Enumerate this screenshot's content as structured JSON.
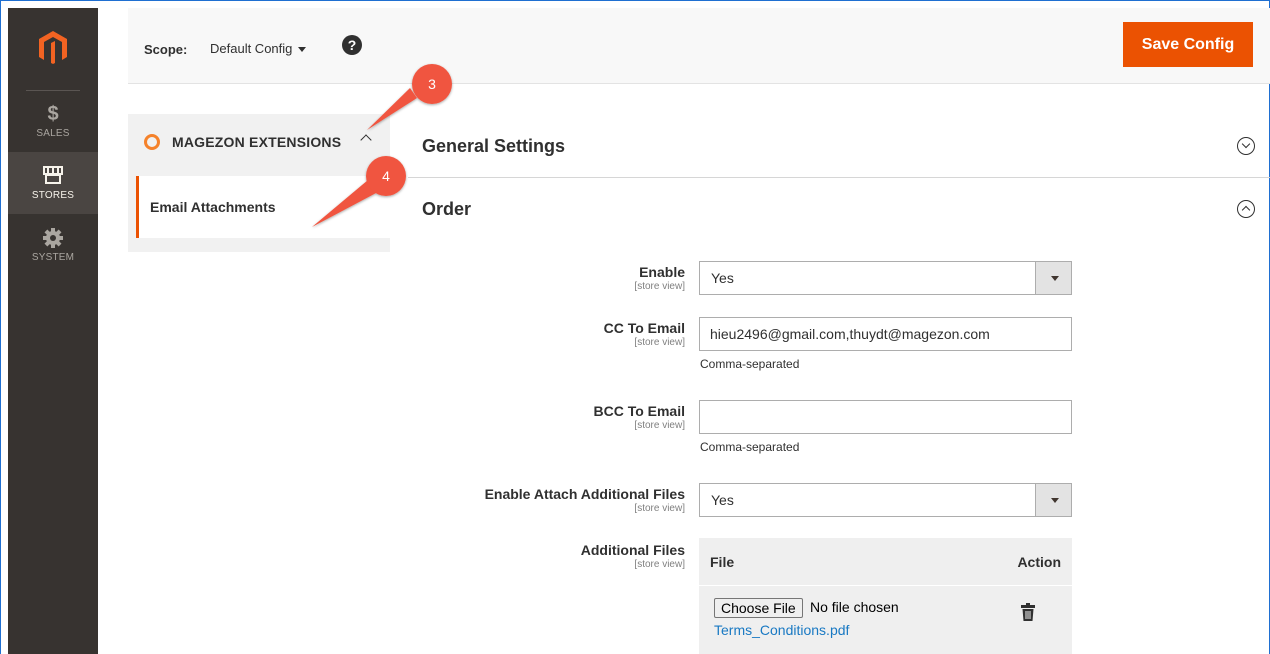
{
  "sidebar": {
    "items": [
      {
        "label": "SALES",
        "icon": "dollar-icon",
        "glyph": "$"
      },
      {
        "label": "STORES",
        "icon": "store-icon",
        "glyph": ""
      },
      {
        "label": "SYSTEM",
        "icon": "gear-icon",
        "glyph": ""
      }
    ],
    "active": "STORES"
  },
  "header": {
    "scope_label": "Scope:",
    "scope_value": "Default Config",
    "help_glyph": "?",
    "save_label": "Save Config"
  },
  "config_nav": {
    "group_label": "MAGEZON EXTENSIONS",
    "item_label": "Email Attachments"
  },
  "sections": {
    "general": "General Settings",
    "order": "Order"
  },
  "form": {
    "enable": {
      "label": "Enable",
      "scope": "[store view]",
      "value": "Yes"
    },
    "cc": {
      "label": "CC To Email",
      "scope": "[store view]",
      "value": "hieu2496@gmail.com,thuydt@magezon.com",
      "note": "Comma-separated"
    },
    "bcc": {
      "label": "BCC To Email",
      "scope": "[store view]",
      "value": "",
      "note": "Comma-separated"
    },
    "attach": {
      "label": "Enable Attach Additional Files",
      "scope": "[store view]",
      "value": "Yes"
    },
    "files": {
      "label": "Additional Files",
      "scope": "[store view]",
      "col_file": "File",
      "col_action": "Action",
      "choose_label": "Choose File",
      "no_file": "No file chosen",
      "file_name": "Terms_Conditions.pdf"
    }
  },
  "callouts": {
    "first": "3",
    "second": "4"
  },
  "colors": {
    "accent": "#eb5202",
    "callout": "#f0553f",
    "link": "#1979c3",
    "sidebar": "#373330"
  }
}
